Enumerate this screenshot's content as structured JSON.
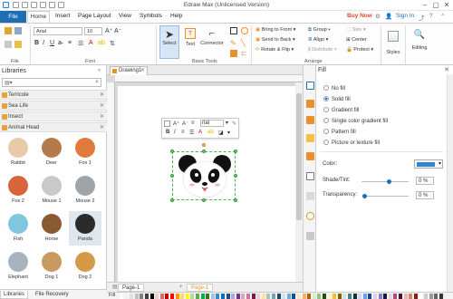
{
  "window": {
    "title": "Edraw Max (Unlicensed Version)"
  },
  "menu": {
    "items": [
      "File",
      "Home",
      "Insert",
      "Page Layout",
      "View",
      "Symbols",
      "Help"
    ],
    "buy_now": "Buy Now",
    "sign_in": "Sign In"
  },
  "ribbon": {
    "file_label": "File",
    "font_group": "Font",
    "font_name": "Arial",
    "font_size": "10",
    "basic_tools_group": "Basic Tools",
    "select_label": "Select",
    "text_label": "Text",
    "connector_label": "Connector",
    "arrange_group": "Arrange",
    "bring_to_front": "Bring to Front",
    "send_to_back": "Send to Back",
    "rotate_flip": "Rotate & Flip",
    "group": "Group",
    "align": "Align",
    "distribute": "Distribute",
    "size": "Size",
    "center": "Center",
    "protect": "Protect",
    "styles_label": "Styles",
    "editing_label": "Editing"
  },
  "libraries": {
    "title": "Libraries",
    "categories": [
      "Terricole",
      "Sea Life",
      "Insect",
      "Animal Head"
    ],
    "shapes": [
      {
        "label": "Rabbit",
        "color": "#e8c9a8"
      },
      {
        "label": "Deer",
        "color": "#b57a4a"
      },
      {
        "label": "Fox 1",
        "color": "#e07a3a"
      },
      {
        "label": "Fox 2",
        "color": "#d9643a"
      },
      {
        "label": "Mouse 1",
        "color": "#c9c9c9"
      },
      {
        "label": "Mouse 2",
        "color": "#9fa4a8"
      },
      {
        "label": "Fish",
        "color": "#7fc6e0"
      },
      {
        "label": "Horse",
        "color": "#8a5a33"
      },
      {
        "label": "Panda",
        "color": "#2b2b2b"
      },
      {
        "label": "Elephant",
        "color": "#a9b3bd"
      },
      {
        "label": "Dog 1",
        "color": "#c89a60"
      },
      {
        "label": "Dog 2",
        "color": "#d49a4a"
      }
    ],
    "tabs": [
      "Libraries",
      "File Recovery"
    ]
  },
  "document": {
    "tab": "Drawing1"
  },
  "floating_toolbar": {
    "font": "rial"
  },
  "pages": {
    "tab_a": "Page-1",
    "tab_b": "Page-1"
  },
  "colors_label": "Fill",
  "fill_panel": {
    "title": "Fill",
    "options": [
      "No fill",
      "Solid fill",
      "Gradient fill",
      "Single color gradient fill",
      "Pattern fill",
      "Picture or texture fill"
    ],
    "selected": "Solid fill",
    "color_label": "Color:",
    "color_value": "#2f86d6",
    "shade_label": "Shade/Tint:",
    "shade_value": "0 %",
    "transparency_label": "Transparency:",
    "transparency_value": "0 %"
  },
  "palette": [
    "#ffffff",
    "#f2f2f2",
    "#e0e0e0",
    "#bfbfbf",
    "#808080",
    "#404040",
    "#000000",
    "#f4cccc",
    "#e06666",
    "#c00000",
    "#ff0000",
    "#ff9900",
    "#ffd966",
    "#ffff00",
    "#b6d7a8",
    "#6aa84f",
    "#00b050",
    "#38761d",
    "#9fc5e8",
    "#3d85c6",
    "#0070c0",
    "#1f4e79",
    "#b4a7d6",
    "#7030a0",
    "#d5a6bd",
    "#c27ba0",
    "#741b47",
    "#ead1dc",
    "#ffe599",
    "#a2c4c9",
    "#76a5af",
    "#134f5c",
    "#cfe2f3",
    "#6fa8dc",
    "#0b5394",
    "#fce5cd",
    "#f6b26b",
    "#b45f06",
    "#d9ead3",
    "#93c47d",
    "#274e13",
    "#fff2cc",
    "#f1c232",
    "#7f6000",
    "#d0e0e3",
    "#45818e",
    "#0c343d",
    "#c9daf8",
    "#6d9eeb",
    "#1c4587",
    "#d9d2e9",
    "#8e7cc3",
    "#20124d",
    "#ead1dc",
    "#a64d79",
    "#4c1130",
    "#e6b8af",
    "#dd7e6b",
    "#85200c",
    "#ffffff",
    "#cccccc",
    "#999999",
    "#666666",
    "#333333"
  ]
}
